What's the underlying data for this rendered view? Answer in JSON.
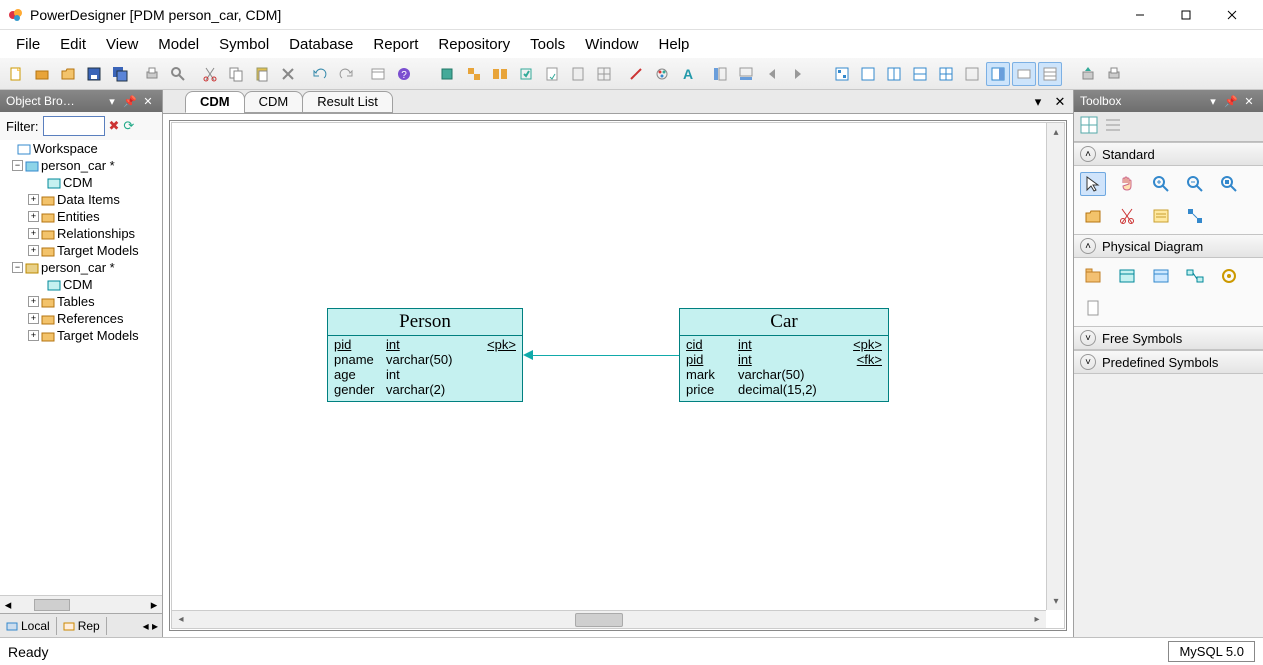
{
  "window": {
    "title": "PowerDesigner [PDM person_car, CDM]"
  },
  "menu": [
    "File",
    "Edit",
    "View",
    "Model",
    "Symbol",
    "Database",
    "Report",
    "Repository",
    "Tools",
    "Window",
    "Help"
  ],
  "browser": {
    "title": "Object Bro…",
    "filter_label": "Filter:",
    "filter_value": "",
    "tree": {
      "root": "Workspace",
      "models": [
        {
          "name": "person_car *",
          "diagram": "CDM",
          "children": [
            "Data Items",
            "Entities",
            "Relationships",
            "Target Models"
          ]
        },
        {
          "name": "person_car *",
          "diagram": "CDM",
          "children": [
            "Tables",
            "References",
            "Target Models"
          ]
        }
      ]
    },
    "bottom_tabs": [
      "Local",
      "Rep"
    ]
  },
  "doctabs": [
    "CDM",
    "CDM",
    "Result List"
  ],
  "entities": {
    "person": {
      "title": "Person",
      "rows": [
        {
          "name": "pid",
          "type": "int",
          "key": "<pk>",
          "u": true
        },
        {
          "name": "pname",
          "type": "varchar(50)",
          "key": ""
        },
        {
          "name": "age",
          "type": "int",
          "key": ""
        },
        {
          "name": "gender",
          "type": "varchar(2)",
          "key": ""
        }
      ]
    },
    "car": {
      "title": "Car",
      "rows": [
        {
          "name": "cid",
          "type": "int",
          "key": "<pk>",
          "u": true
        },
        {
          "name": "pid",
          "type": "int",
          "key": "<fk>",
          "u": true
        },
        {
          "name": "mark",
          "type": "varchar(50)",
          "key": ""
        },
        {
          "name": "price",
          "type": "decimal(15,2)",
          "key": ""
        }
      ]
    }
  },
  "toolbox": {
    "title": "Toolbox",
    "sections": [
      "Standard",
      "Physical Diagram",
      "Free Symbols",
      "Predefined Symbols"
    ]
  },
  "status": {
    "text": "Ready",
    "db": "MySQL 5.0"
  }
}
